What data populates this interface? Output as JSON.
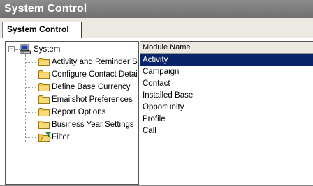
{
  "window": {
    "title": "System Control"
  },
  "tabs": [
    {
      "label": "System Control",
      "active": true
    }
  ],
  "tree": {
    "root": {
      "label": "System",
      "icon": "computer-icon",
      "expanded": true,
      "expander_symbol": "−"
    },
    "items": [
      {
        "label": "Activity and Reminder Se",
        "icon": "folder-icon"
      },
      {
        "label": "Configure Contact Detail",
        "icon": "folder-icon"
      },
      {
        "label": "Define Base Currency",
        "icon": "folder-icon"
      },
      {
        "label": "Emailshot Preferences",
        "icon": "folder-icon"
      },
      {
        "label": "Report Options",
        "icon": "folder-icon"
      },
      {
        "label": "Business Year Settings",
        "icon": "folder-icon"
      },
      {
        "label": "Filter",
        "icon": "filter-folder-icon"
      }
    ]
  },
  "list": {
    "column_header": "Module Name",
    "rows": [
      {
        "label": "Activity",
        "selected": true
      },
      {
        "label": "Campaign",
        "selected": false
      },
      {
        "label": "Contact",
        "selected": false
      },
      {
        "label": "Installed Base",
        "selected": false
      },
      {
        "label": "Opportunity",
        "selected": false
      },
      {
        "label": "Profile",
        "selected": false
      },
      {
        "label": "Call",
        "selected": false
      }
    ]
  },
  "colors": {
    "titlebar": "#7a7a7a",
    "selection": "#0a246a",
    "folder": "#f2c94c",
    "panel": "#ebe9e1"
  }
}
